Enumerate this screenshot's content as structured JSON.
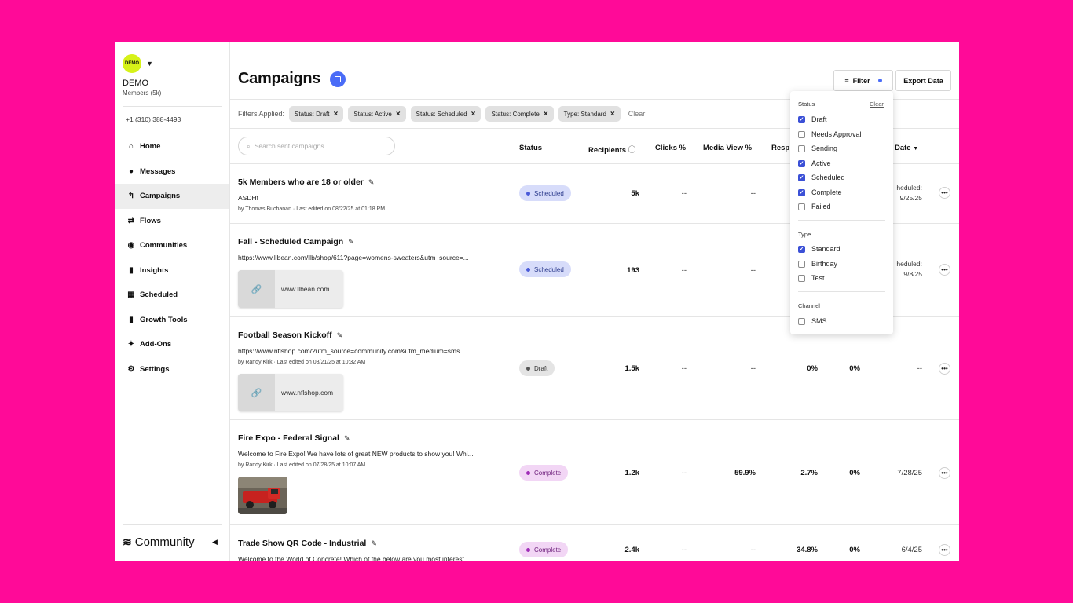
{
  "account": {
    "avatar_text": "DEMO",
    "name": "DEMO",
    "members": "Members (5k)",
    "phone": "+1 (310) 388-4493"
  },
  "nav": [
    {
      "label": "Home",
      "icon": "home-icon",
      "glyph": "⌂"
    },
    {
      "label": "Messages",
      "icon": "chat-bubble-icon",
      "glyph": "●"
    },
    {
      "label": "Campaigns",
      "icon": "campaign-arrow-icon",
      "glyph": "↰"
    },
    {
      "label": "Flows",
      "icon": "flows-arrows-icon",
      "glyph": "⇄"
    },
    {
      "label": "Communities",
      "icon": "people-icon",
      "glyph": "👥"
    },
    {
      "label": "Insights",
      "icon": "bar-chart-icon",
      "glyph": "▮"
    },
    {
      "label": "Scheduled",
      "icon": "calendar-icon",
      "glyph": "▦"
    },
    {
      "label": "Growth Tools",
      "icon": "bookmark-icon",
      "glyph": "▮"
    },
    {
      "label": "Add-Ons",
      "icon": "sparkle-icon",
      "glyph": "✦"
    },
    {
      "label": "Settings",
      "icon": "gear-icon",
      "glyph": "⚙"
    }
  ],
  "brand": {
    "name": "Community"
  },
  "header": {
    "title": "Campaigns",
    "filter_label": "Filter",
    "export_label": "Export Data"
  },
  "filters_bar": {
    "label": "Filters Applied:",
    "chips": [
      "Status: Draft",
      "Status: Active",
      "Status: Scheduled",
      "Status: Complete",
      "Type: Standard"
    ],
    "clear": "Clear"
  },
  "search": {
    "placeholder": "Search sent campaigns"
  },
  "columns": {
    "status": "Status",
    "recipients": "Recipients",
    "clicks": "Clicks %",
    "media_view": "Media View %",
    "response": "Resp",
    "date": "Date"
  },
  "rows": [
    {
      "name": "5k Members who are 18 or older",
      "text": "ASDHf",
      "by": "by Thomas Buchanan · Last edited on 08/22/25 at 01:18 PM",
      "status": "Scheduled",
      "recipients": "5k",
      "clicks": "--",
      "media_view": "--",
      "date_line1": "heduled:",
      "date_line2": "9/25/25"
    },
    {
      "name": "Fall - Scheduled Campaign",
      "text": "https://www.llbean.com/llb/shop/611?page=womens-sweaters&utm_source=...",
      "link": "www.llbean.com",
      "status": "Scheduled",
      "recipients": "193",
      "clicks": "--",
      "media_view": "--",
      "date_line1": "heduled:",
      "date_line2": "9/8/25"
    },
    {
      "name": "Football Season Kickoff",
      "text": "https://www.nflshop.com/?utm_source=community.com&utm_medium=sms...",
      "by": "by Randy Kirk · Last edited on 08/21/25 at 10:32 AM",
      "link": "www.nflshop.com",
      "status": "Draft",
      "recipients": "1.5k",
      "clicks": "--",
      "media_view": "--",
      "response": "0%",
      "optout": "0%",
      "date": "--"
    },
    {
      "name": "Fire Expo - Federal Signal",
      "text": "Welcome to Fire Expo! We have lots of great NEW products to show you! Whi...",
      "by": "by Randy Kirk · Last edited on 07/28/25 at 10:07 AM",
      "status": "Complete",
      "recipients": "1.2k",
      "clicks": "--",
      "media_view": "59.9%",
      "response": "2.7%",
      "optout": "0%",
      "date": "7/28/25"
    },
    {
      "name": "Trade Show QR Code - Industrial",
      "text": "Welcome to the World of Concrete! Which of the below are you most interest...",
      "status": "Complete",
      "recipients": "2.4k",
      "clicks": "--",
      "media_view": "--",
      "response": "34.8%",
      "optout": "0%",
      "date": "6/4/25"
    }
  ],
  "filter_dropdown": {
    "status_title": "Status",
    "clear": "Clear",
    "status_options": [
      {
        "label": "Draft",
        "checked": true
      },
      {
        "label": "Needs Approval",
        "checked": false
      },
      {
        "label": "Sending",
        "checked": false
      },
      {
        "label": "Active",
        "checked": true
      },
      {
        "label": "Scheduled",
        "checked": true
      },
      {
        "label": "Complete",
        "checked": true
      },
      {
        "label": "Failed",
        "checked": false
      }
    ],
    "type_title": "Type",
    "type_options": [
      {
        "label": "Standard",
        "checked": true
      },
      {
        "label": "Birthday",
        "checked": false
      },
      {
        "label": "Test",
        "checked": false
      }
    ],
    "channel_title": "Channel",
    "channel_options": [
      {
        "label": "SMS",
        "checked": false
      }
    ]
  },
  "colors": {
    "background": "#ff0a98",
    "accent": "#4a6cf7",
    "avatar": "#d6f218",
    "checkbox": "#3b50d6"
  }
}
